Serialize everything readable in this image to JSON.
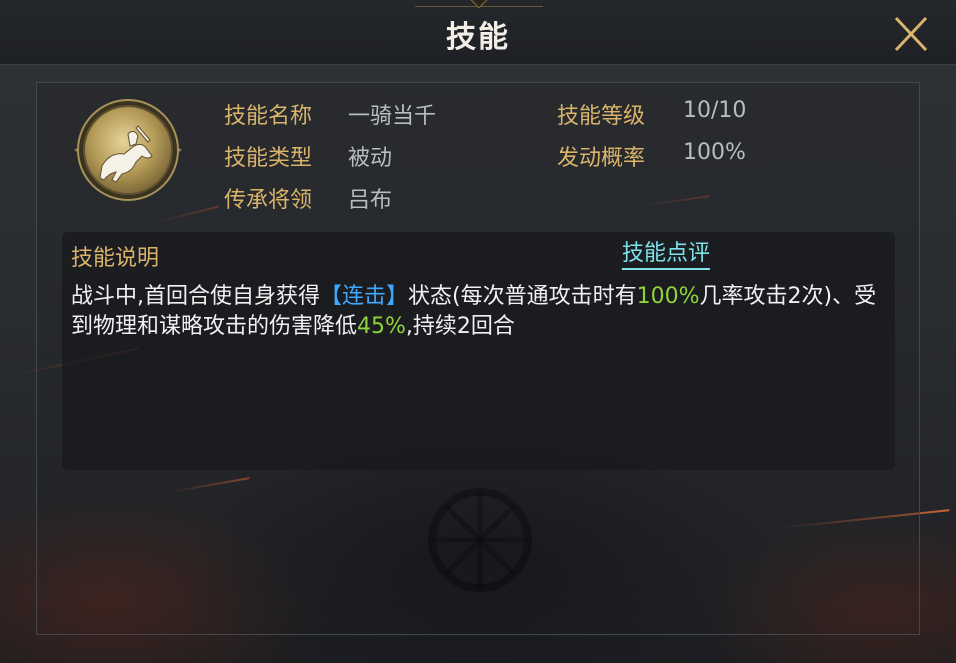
{
  "header": {
    "title": "技能"
  },
  "skill": {
    "icon": "mounted-warrior-emblem",
    "name_label": "技能名称",
    "name_value": "一骑当千",
    "level_label": "技能等级",
    "level_value": "10/10",
    "type_label": "技能类型",
    "type_value": "被动",
    "chance_label": "发动概率",
    "chance_value": "100%",
    "inherit_label": "传承将领",
    "inherit_value": "吕布"
  },
  "description": {
    "title": "技能说明",
    "review_link": "技能点评",
    "segments": {
      "s1": "战斗中,首回合使自身获得",
      "kw": "【连击】",
      "s2": "状态(每次普通攻击时有",
      "n1": "100%",
      "s3": "几率攻击2次)、受到物理和谋略攻击的伤害降低",
      "n2": "45%",
      "s4": ",持续2回合"
    }
  },
  "colors": {
    "label_gold": "#d9b46a",
    "value_gray": "#b9bcc0",
    "keyword_blue": "#3fa8ff",
    "number_green": "#8fd33a",
    "link_cyan": "#7fe1ea"
  }
}
